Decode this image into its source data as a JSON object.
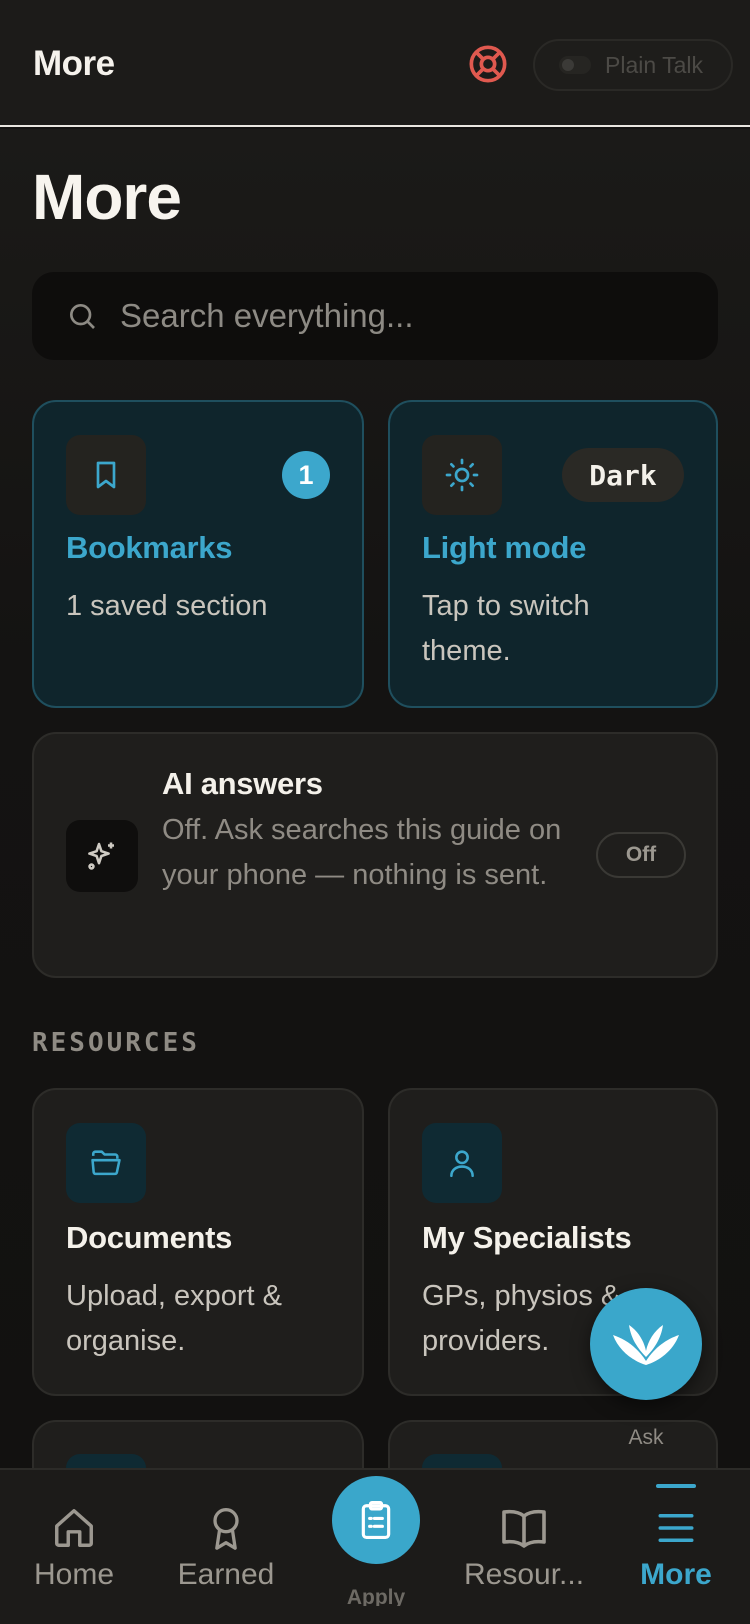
{
  "header": {
    "title": "More",
    "plain_talk_label": "Plain Talk"
  },
  "page": {
    "title": "More"
  },
  "search": {
    "placeholder": "Search everything..."
  },
  "bookmarks": {
    "title": "Bookmarks",
    "description": "1 saved section",
    "count": "1"
  },
  "theme": {
    "title": "Light mode",
    "description": "Tap to switch theme.",
    "current": "Dark"
  },
  "ai": {
    "title": "AI answers",
    "description": "Off. Ask searches this guide on your phone — nothing is sent.",
    "toggle_label": "Off"
  },
  "resources": {
    "section_label": "RESOURCES",
    "cards": [
      {
        "title": "Documents",
        "description": "Upload, export & organise.",
        "icon": "folder-icon"
      },
      {
        "title": "My Specialists",
        "description": "GPs, physios & providers.",
        "icon": "person-icon"
      }
    ]
  },
  "fab": {
    "label": "Ask"
  },
  "tabbar": {
    "home": "Home",
    "earned": "Earned",
    "apply": "Apply",
    "resources": "Resour...",
    "more": "More"
  },
  "colors": {
    "accent": "#3ca7cc",
    "help_icon": "#e0594f",
    "background": "#141312"
  }
}
